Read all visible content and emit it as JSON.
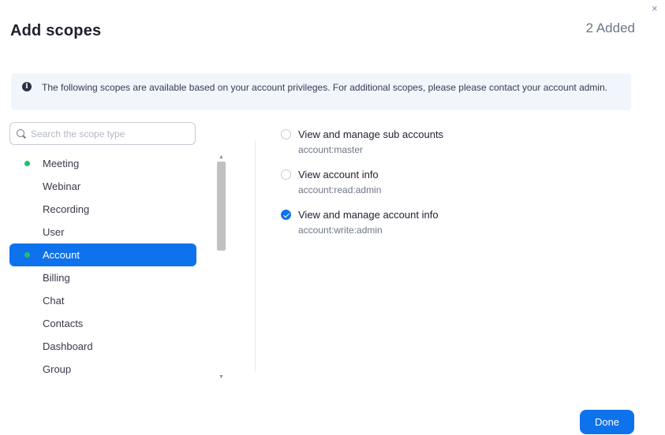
{
  "dialog": {
    "close_icon": "×",
    "title": "Add scopes",
    "added_count": "2 Added",
    "info_icon": "i",
    "info_text": "The following scopes are available based on your account privileges. For additional scopes, please please contact your account admin.",
    "done_label": "Done"
  },
  "search": {
    "placeholder": "Search the scope type",
    "value": ""
  },
  "categories": [
    {
      "label": "Meeting",
      "has_selected": true,
      "active": false
    },
    {
      "label": "Webinar",
      "has_selected": false,
      "active": false
    },
    {
      "label": "Recording",
      "has_selected": false,
      "active": false
    },
    {
      "label": "User",
      "has_selected": false,
      "active": false
    },
    {
      "label": "Account",
      "has_selected": true,
      "active": true
    },
    {
      "label": "Billing",
      "has_selected": false,
      "active": false
    },
    {
      "label": "Chat",
      "has_selected": false,
      "active": false
    },
    {
      "label": "Contacts",
      "has_selected": false,
      "active": false
    },
    {
      "label": "Dashboard",
      "has_selected": false,
      "active": false
    },
    {
      "label": "Group",
      "has_selected": false,
      "active": false
    }
  ],
  "scopes": [
    {
      "name": "View and manage sub accounts",
      "code": "account:master",
      "checked": false
    },
    {
      "name": "View account info",
      "code": "account:read:admin",
      "checked": false
    },
    {
      "name": "View and manage account info",
      "code": "account:write:admin",
      "checked": true
    }
  ],
  "colors": {
    "accent": "#0e72ed",
    "selected_dot": "#23c06b",
    "banner_bg": "#f1f6fd"
  },
  "icons": {
    "close": "close-icon",
    "info": "info-icon",
    "search": "search-icon"
  }
}
